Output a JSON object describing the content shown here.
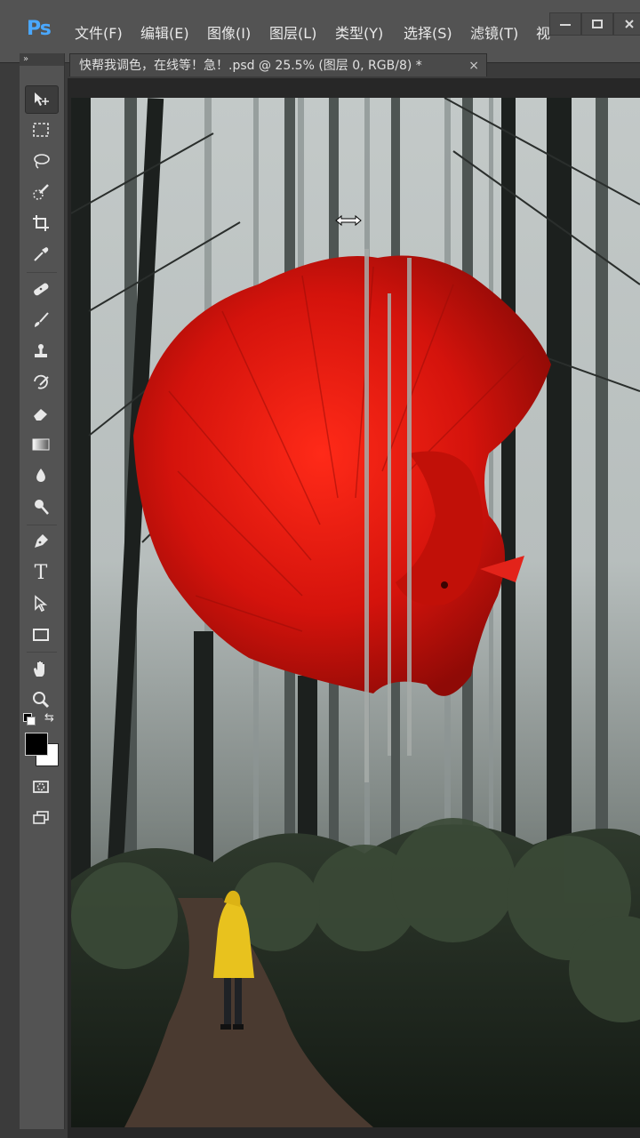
{
  "app": {
    "logo": "Ps"
  },
  "menu": {
    "items": [
      "文件(F)",
      "编辑(E)",
      "图像(I)",
      "图层(L)",
      "类型(Y)",
      "选择(S)",
      "滤镜(T)",
      "视"
    ]
  },
  "window_controls": {
    "minimize_icon": "minimize-icon",
    "restore_icon": "restore-icon"
  },
  "document": {
    "tab_title": "快帮我调色，在线等！急！.psd @ 25.5% (图层 0, RGB/8) *",
    "close_glyph": "×"
  },
  "toolbar": {
    "grip": "»",
    "tools": [
      "move-tool-icon",
      "marquee-tool-icon",
      "lasso-tool-icon",
      "quick-selection-tool-icon",
      "crop-tool-icon",
      "eyedropper-tool-icon",
      "healing-brush-tool-icon",
      "brush-tool-icon",
      "clone-stamp-tool-icon",
      "history-brush-tool-icon",
      "eraser-tool-icon",
      "gradient-tool-icon",
      "blur-tool-icon",
      "dodge-tool-icon",
      "pen-tool-icon",
      "type-tool-icon",
      "path-selection-tool-icon",
      "rectangle-tool-icon",
      "hand-tool-icon",
      "zoom-tool-icon"
    ],
    "type_tool_glyph": "T",
    "foreground_color": "#000000",
    "background_color": "#ffffff"
  },
  "canvas": {
    "subject": "red betta fish over misty forest with person in yellow raincoat",
    "fish_color": "#d4130c",
    "raincoat_color": "#e8c21e"
  }
}
